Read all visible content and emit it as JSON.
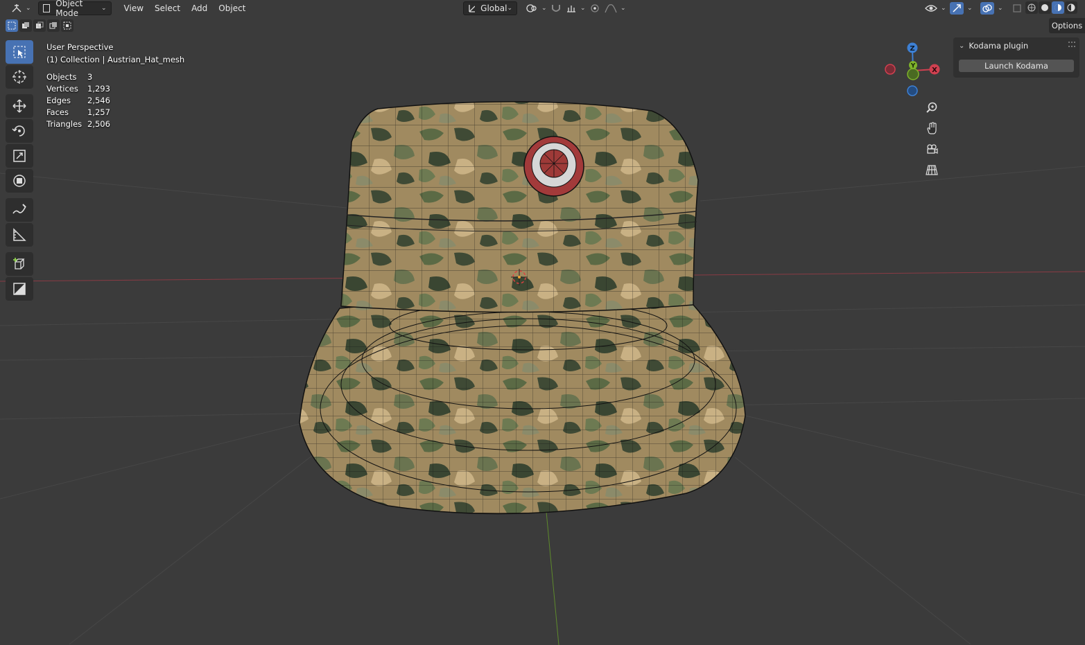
{
  "header": {
    "editor_icon": "editor-type-icon",
    "mode_label": "Object Mode",
    "menus": [
      "View",
      "Select",
      "Add",
      "Object"
    ],
    "orientation_label": "Global"
  },
  "overlay": {
    "perspective": "User Perspective",
    "collection": "(1) Collection | Austrian_Hat_mesh",
    "stats": [
      {
        "key": "Objects",
        "value": "3"
      },
      {
        "key": "Vertices",
        "value": "1,293"
      },
      {
        "key": "Edges",
        "value": "2,546"
      },
      {
        "key": "Faces",
        "value": "1,257"
      },
      {
        "key": "Triangles",
        "value": "2,506"
      }
    ]
  },
  "right_header": {
    "options_label": "Options"
  },
  "npanel": {
    "panel_title": "Kodama plugin",
    "launch_button": "Launch Kodama"
  },
  "gizmo": {
    "z": "Z",
    "y": "Y",
    "x": "X"
  },
  "colors": {
    "viewport_bg": "#3b3b3b",
    "accent_blue": "#4772b3",
    "axis_red": "#d04050",
    "axis_green": "#7fb32a",
    "axis_blue": "#3d80d4"
  }
}
